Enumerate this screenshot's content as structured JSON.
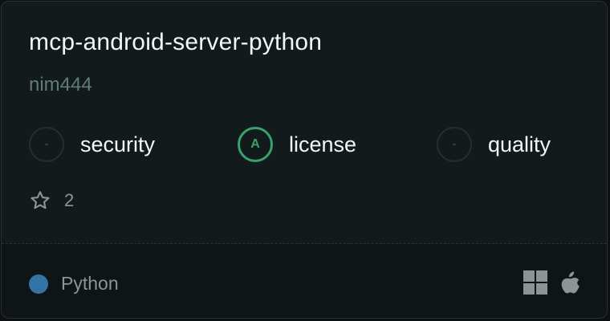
{
  "card": {
    "title": "mcp-android-server-python",
    "owner": "nim444",
    "scores": [
      {
        "label": "security",
        "grade": "-",
        "state": "empty"
      },
      {
        "label": "license",
        "grade": "A",
        "state": "graded"
      },
      {
        "label": "quality",
        "grade": "-",
        "state": "empty"
      }
    ],
    "stars": {
      "icon": "star-icon",
      "count": "2"
    },
    "language": {
      "name": "Python",
      "color": "#3572a5"
    },
    "platforms": [
      "windows-icon",
      "apple-icon"
    ]
  },
  "colors": {
    "background": "#121a1c",
    "footer": "#0f1517",
    "accent_green": "#3aa06c",
    "muted_text": "#8b9596",
    "owner_text": "#5f7d76"
  }
}
